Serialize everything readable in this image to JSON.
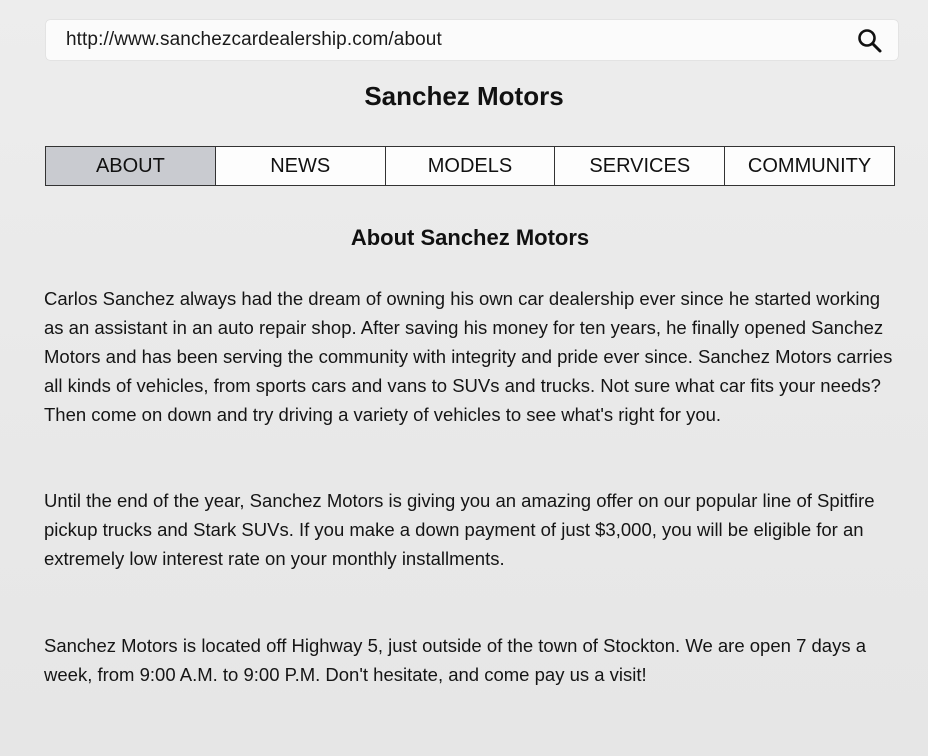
{
  "browser": {
    "url": "http://www.sanchezcardealership.com/about",
    "search_icon": "search-icon"
  },
  "site": {
    "title": "Sanchez Motors"
  },
  "nav": {
    "tabs": [
      {
        "label": "ABOUT",
        "active": true
      },
      {
        "label": "NEWS",
        "active": false
      },
      {
        "label": "MODELS",
        "active": false
      },
      {
        "label": "SERVICES",
        "active": false
      },
      {
        "label": "COMMUNITY",
        "active": false
      }
    ],
    "active_color": "#c9cbd0"
  },
  "main": {
    "heading": "About Sanchez Motors",
    "paragraphs": [
      "Carlos Sanchez always had the dream of owning his own car dealership ever since he started working as an assistant in an auto repair shop. After saving his money for ten years, he finally opened Sanchez Motors and has been serving the community with integrity and pride ever since. Sanchez Motors carries all kinds of vehicles, from sports cars and vans to SUVs and trucks. Not sure what car fits your needs? Then come on down and try driving a variety of vehicles to see what's right for you.",
      "Until the end of the year, Sanchez Motors is giving you an amazing offer on our popular line of Spitfire pickup trucks and Stark SUVs. If you make a down payment of just $3,000, you will be eligible for an extremely low interest rate on your monthly installments.",
      "Sanchez Motors is located off Highway 5, just outside of the town of Stockton. We are open 7 days a week, from 9:00 A.M. to 9:00 P.M. Don't hesitate, and come pay us a visit!"
    ]
  }
}
